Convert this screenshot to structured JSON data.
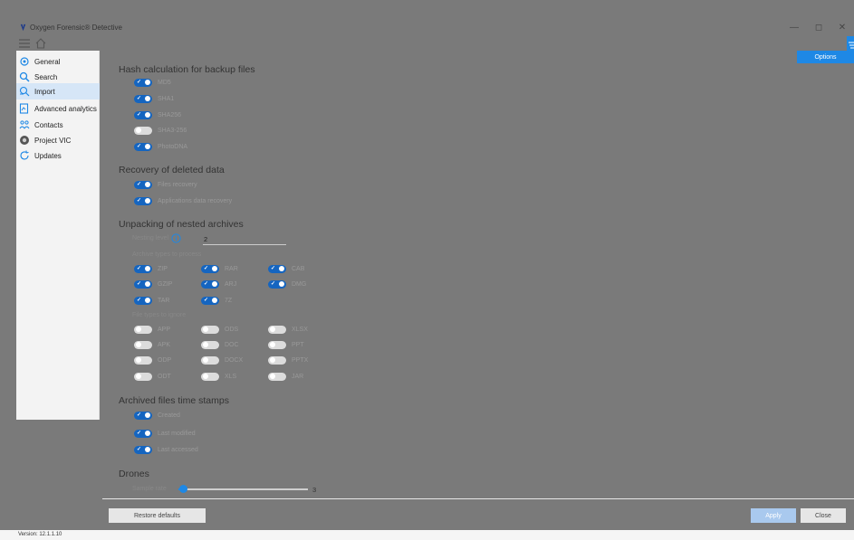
{
  "app": {
    "title": "Oxygen Forensic® Detective"
  },
  "window_controls": {
    "minimize": "—",
    "restore": "◻",
    "close": "✕"
  },
  "sidebar": {
    "items": [
      {
        "label": "General",
        "icon": "gear-icon"
      },
      {
        "label": "Search",
        "icon": "search-icon"
      },
      {
        "label": "Import",
        "icon": "import-icon",
        "active": true
      },
      {
        "label": "Advanced analytics",
        "icon": "analytics-icon"
      },
      {
        "label": "Contacts",
        "icon": "contacts-icon"
      },
      {
        "label": "Project VIC",
        "icon": "project-vic-icon"
      },
      {
        "label": "Updates",
        "icon": "refresh-icon"
      }
    ]
  },
  "options_button": "Options",
  "hash": {
    "title": "Hash calculation for backup files",
    "items": [
      {
        "label": "MD5",
        "on": true
      },
      {
        "label": "SHA1",
        "on": true
      },
      {
        "label": "SHA256",
        "on": true
      },
      {
        "label": "SHA3-256",
        "on": false
      },
      {
        "label": "PhotoDNA",
        "on": true
      }
    ]
  },
  "recovery": {
    "title": "Recovery of deleted data",
    "items": [
      {
        "label": "Files recovery",
        "on": true
      },
      {
        "label": "Applications data recovery",
        "on": true
      }
    ]
  },
  "unpacking": {
    "title": "Unpacking of nested archives",
    "nesting_label": "Nesting level",
    "nesting_value": "2",
    "archive_types_label": "Archive types to process",
    "archive_types": [
      {
        "label": "ZIP",
        "on": true
      },
      {
        "label": "RAR",
        "on": true
      },
      {
        "label": "CAB",
        "on": true
      },
      {
        "label": "GZIP",
        "on": true
      },
      {
        "label": "ARJ",
        "on": true
      },
      {
        "label": "DMG",
        "on": true
      },
      {
        "label": "TAR",
        "on": true
      },
      {
        "label": "7Z",
        "on": true
      }
    ],
    "ignore_label": "File types to ignore",
    "ignore_types": [
      {
        "label": "APP",
        "on": false
      },
      {
        "label": "ODS",
        "on": false
      },
      {
        "label": "XLSX",
        "on": false
      },
      {
        "label": "APK",
        "on": false
      },
      {
        "label": "DOC",
        "on": false
      },
      {
        "label": "PPT",
        "on": false
      },
      {
        "label": "ODP",
        "on": false
      },
      {
        "label": "DOCX",
        "on": false
      },
      {
        "label": "PPTX",
        "on": false
      },
      {
        "label": "ODT",
        "on": false
      },
      {
        "label": "XLS",
        "on": false
      },
      {
        "label": "JAR",
        "on": false
      }
    ]
  },
  "timestamps": {
    "title": "Archived files time stamps",
    "items": [
      {
        "label": "Created",
        "on": true
      },
      {
        "label": "Last modified",
        "on": true
      },
      {
        "label": "Last accessed",
        "on": true
      }
    ]
  },
  "drones": {
    "title": "Drones",
    "sample_rate_label": "Sample rate",
    "sample_rate_value": "3",
    "sample_rate_fraction": 0.04
  },
  "footer": {
    "restore_defaults": "Restore defaults",
    "apply": "Apply",
    "close": "Close"
  },
  "status": {
    "version": "Version: 12.1.1.10"
  },
  "colors": {
    "accent": "#1e88e5",
    "toggle_on": "#1565c0",
    "toggle_off": "#dcdcdc",
    "active_nav": "#d6e6f7"
  }
}
